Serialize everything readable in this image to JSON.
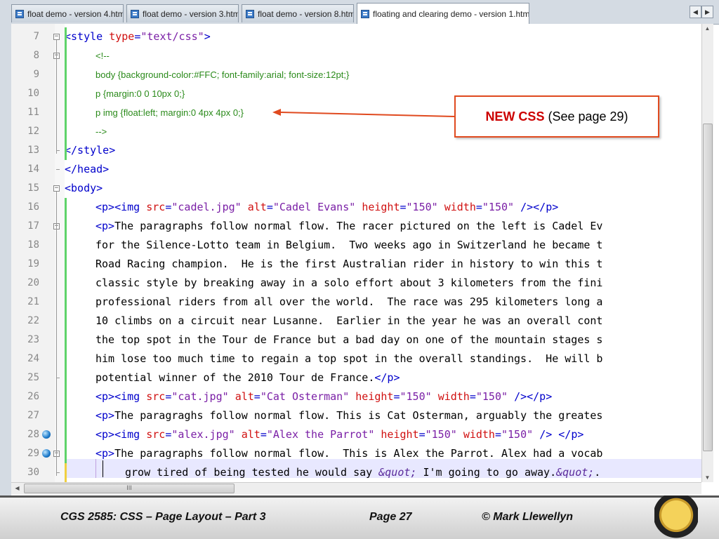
{
  "tabs": [
    {
      "label": "float demo - version 4.html",
      "active": false
    },
    {
      "label": "float demo - version 3.html",
      "active": false
    },
    {
      "label": "float demo - version 8.html",
      "active": false
    },
    {
      "label": "floating and clearing demo - version 1.html",
      "active": true
    }
  ],
  "tab_scroll": {
    "left": "◀",
    "right": "▶"
  },
  "editor": {
    "line_numbers": [
      "7",
      "8",
      "9",
      "10",
      "11",
      "12",
      "13",
      "14",
      "15",
      "16",
      "17",
      "18",
      "19",
      "20",
      "21",
      "22",
      "23",
      "24",
      "25",
      "26",
      "27",
      "28",
      "29",
      "30"
    ],
    "lines": [
      [
        {
          "t": "<style ",
          "c": "tg"
        },
        {
          "t": "type",
          "c": "at"
        },
        {
          "t": "=",
          "c": "tg"
        },
        {
          "t": "\"text/css\"",
          "c": "va"
        },
        {
          "t": ">",
          "c": "tg"
        }
      ],
      [
        {
          "t": "<!--",
          "c": "cmt"
        }
      ],
      [
        {
          "t": "body {background-color:#FFC; font-family:arial; font-size:12pt;}",
          "c": "cmt"
        }
      ],
      [
        {
          "t": "p {margin:0 0 10px 0;}",
          "c": "cmt"
        }
      ],
      [
        {
          "t": "p img {float:left; margin:0 4px 4px 0;}",
          "c": "cmt"
        }
      ],
      [
        {
          "t": "-->",
          "c": "cmt"
        }
      ],
      [
        {
          "t": "</style>",
          "c": "tg"
        }
      ],
      [
        {
          "t": "</head>",
          "c": "tg"
        }
      ],
      [
        {
          "t": "<body>",
          "c": "tg"
        }
      ],
      [
        {
          "t": "<p><img ",
          "c": "tg"
        },
        {
          "t": "src",
          "c": "at"
        },
        {
          "t": "=",
          "c": "tg"
        },
        {
          "t": "\"cadel.jpg\" ",
          "c": "va"
        },
        {
          "t": "alt",
          "c": "at"
        },
        {
          "t": "=",
          "c": "tg"
        },
        {
          "t": "\"Cadel Evans\" ",
          "c": "va"
        },
        {
          "t": "height",
          "c": "at"
        },
        {
          "t": "=",
          "c": "tg"
        },
        {
          "t": "\"150\" ",
          "c": "va"
        },
        {
          "t": "width",
          "c": "at"
        },
        {
          "t": "=",
          "c": "tg"
        },
        {
          "t": "\"150\" ",
          "c": "va"
        },
        {
          "t": "/></p>",
          "c": "tg"
        }
      ],
      [
        {
          "t": "<p>",
          "c": "tg"
        },
        {
          "t": "The paragraphs follow normal flow. The racer pictured on the left is Cadel Ev",
          "c": ""
        }
      ],
      [
        {
          "t": "for the Silence-Lotto team in Belgium.  Two weeks ago in Switzerland he became t",
          "c": ""
        }
      ],
      [
        {
          "t": "Road Racing champion.  He is the first Australian rider in history to win this t",
          "c": ""
        }
      ],
      [
        {
          "t": "classic style by breaking away in a solo effort about 3 kilometers from the fini",
          "c": ""
        }
      ],
      [
        {
          "t": "professional riders from all over the world.  The race was 295 kilometers long a",
          "c": ""
        }
      ],
      [
        {
          "t": "10 climbs on a circuit near Lusanne.  Earlier in the year he was an overall cont",
          "c": ""
        }
      ],
      [
        {
          "t": "the top spot in the Tour de France but a bad day on one of the mountain stages s",
          "c": ""
        }
      ],
      [
        {
          "t": "him lose too much time to regain a top spot in the overall standings.  He will b",
          "c": ""
        }
      ],
      [
        {
          "t": "potential winner of the 2010 Tour de France.",
          "c": ""
        },
        {
          "t": "</p>",
          "c": "tg"
        }
      ],
      [
        {
          "t": "<p><img ",
          "c": "tg"
        },
        {
          "t": "src",
          "c": "at"
        },
        {
          "t": "=",
          "c": "tg"
        },
        {
          "t": "\"cat.jpg\" ",
          "c": "va"
        },
        {
          "t": "alt",
          "c": "at"
        },
        {
          "t": "=",
          "c": "tg"
        },
        {
          "t": "\"Cat Osterman\" ",
          "c": "va"
        },
        {
          "t": "height",
          "c": "at"
        },
        {
          "t": "=",
          "c": "tg"
        },
        {
          "t": "\"150\" ",
          "c": "va"
        },
        {
          "t": "width",
          "c": "at"
        },
        {
          "t": "=",
          "c": "tg"
        },
        {
          "t": "\"150\" ",
          "c": "va"
        },
        {
          "t": "/></p>",
          "c": "tg"
        }
      ],
      [
        {
          "t": "<p>",
          "c": "tg"
        },
        {
          "t": "The paragraghs follow normal flow. This is Cat Osterman, arguably the greates",
          "c": ""
        }
      ],
      [
        {
          "t": "<p><img ",
          "c": "tg"
        },
        {
          "t": "src",
          "c": "at"
        },
        {
          "t": "=",
          "c": "tg"
        },
        {
          "t": "\"alex.jpg\" ",
          "c": "va"
        },
        {
          "t": "alt",
          "c": "at"
        },
        {
          "t": "=",
          "c": "tg"
        },
        {
          "t": "\"Alex the Parrot\" ",
          "c": "va"
        },
        {
          "t": "height",
          "c": "at"
        },
        {
          "t": "=",
          "c": "tg"
        },
        {
          "t": "\"150\" ",
          "c": "va"
        },
        {
          "t": "width",
          "c": "at"
        },
        {
          "t": "=",
          "c": "tg"
        },
        {
          "t": "\"150\" ",
          "c": "va"
        },
        {
          "t": "/> </p>",
          "c": "tg"
        }
      ],
      [
        {
          "t": "<p>",
          "c": "tg"
        },
        {
          "t": "The paragraphs follow normal flow.  This is Alex the Parrot. Alex had a vocab",
          "c": ""
        }
      ],
      [
        {
          "t": "grow tired of being tested he would say ",
          "c": ""
        },
        {
          "t": "&quot;",
          "c": "en"
        },
        {
          "t": " I'm going to go away.",
          "c": ""
        },
        {
          "t": "&quot;",
          "c": "en"
        },
        {
          "t": ".",
          "c": ""
        }
      ]
    ]
  },
  "hscroll_grip": "III",
  "callout": {
    "bold": "NEW CSS",
    "rest": " (See page 29)"
  },
  "footer": {
    "course": "CGS 2585: CSS – Page Layout – Part 3",
    "page": "Page 27",
    "copyright": "© Mark Llewellyn"
  },
  "icons": {
    "bookmark": "bookmark-icon",
    "fold": "fold-toggle-icon",
    "logo": "ucf-pegasus-logo"
  },
  "colors": {
    "accent": "#e04a1f",
    "tag": "#0000cc",
    "attr": "#d01010",
    "value": "#7a1fa6",
    "comment": "#2a8a1a"
  }
}
